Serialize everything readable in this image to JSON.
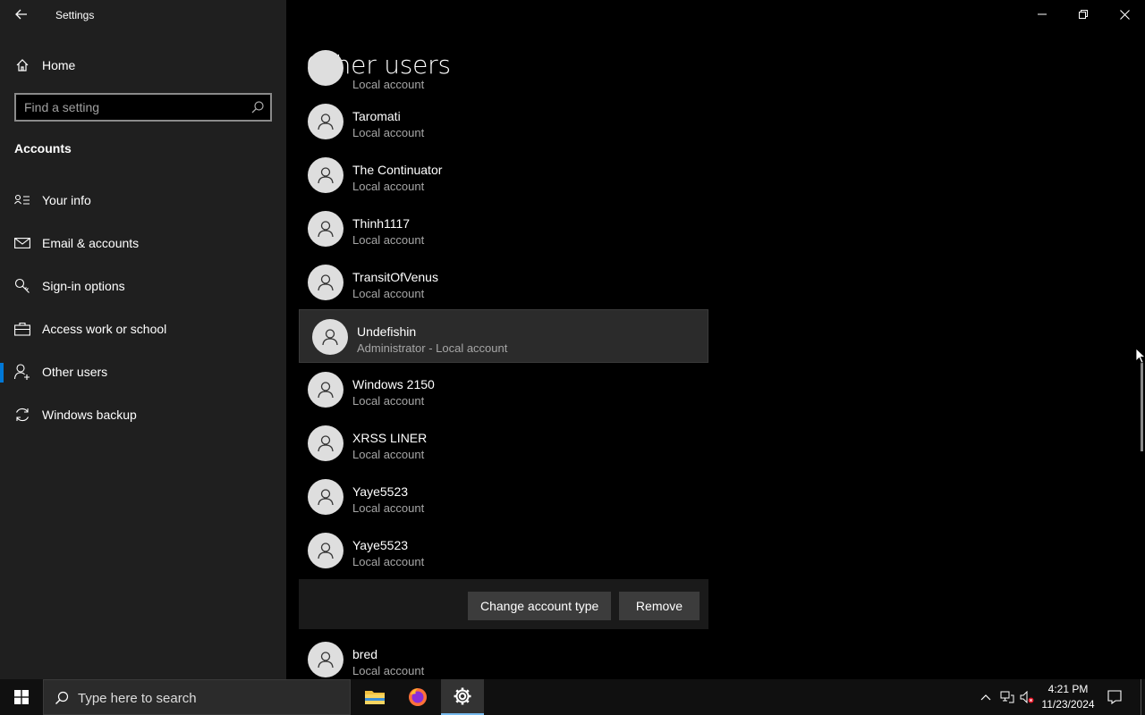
{
  "window": {
    "title": "Settings"
  },
  "sidebar": {
    "home_label": "Home",
    "search_placeholder": "Find a setting",
    "section_title": "Accounts",
    "items": [
      {
        "label": "Your info",
        "icon": "contact-card-icon"
      },
      {
        "label": "Email & accounts",
        "icon": "mail-icon"
      },
      {
        "label": "Sign-in options",
        "icon": "key-icon"
      },
      {
        "label": "Access work or school",
        "icon": "briefcase-icon"
      },
      {
        "label": "Other users",
        "icon": "person-add-icon",
        "active": true
      },
      {
        "label": "Windows backup",
        "icon": "sync-icon"
      }
    ]
  },
  "main": {
    "title": "Other users",
    "users": [
      {
        "name": "",
        "type": "Local account"
      },
      {
        "name": "Taromati",
        "type": "Local account"
      },
      {
        "name": "The Continuator",
        "type": "Local account"
      },
      {
        "name": "Thinh1117",
        "type": "Local account"
      },
      {
        "name": "TransitOfVenus",
        "type": "Local account"
      },
      {
        "name": "Undefishin",
        "type": "Administrator - Local account"
      },
      {
        "name": "Windows 2150",
        "type": "Local account"
      },
      {
        "name": "XRSS LINER",
        "type": "Local account"
      },
      {
        "name": "Yaye5523",
        "type": "Local account"
      },
      {
        "name": "Yaye5523",
        "type": "Local account"
      },
      {
        "name": "bred",
        "type": "Local account"
      }
    ],
    "change_type_label": "Change account type",
    "remove_label": "Remove"
  },
  "taskbar": {
    "search_placeholder": "Type here to search",
    "time": "4:21 PM",
    "date": "11/23/2024"
  },
  "colors": {
    "accent": "#0078d7",
    "sidebar_bg": "#1f1f1f",
    "main_bg": "#000000",
    "selected_row_bg": "#2b2b2b"
  }
}
